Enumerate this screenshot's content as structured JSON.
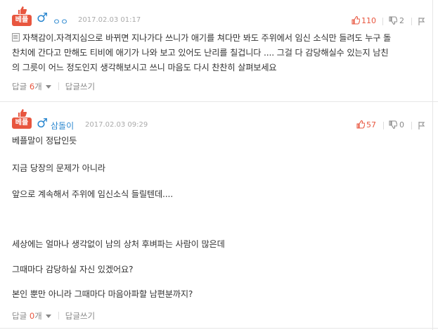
{
  "comments": [
    {
      "badge": "베플",
      "nickname": "ㅇㅇ",
      "date": "2017.02.03 01:17",
      "likes": "110",
      "dislikes": "2",
      "lines": [
        "자책감이.자격지심으로 바뀌면 지나가다 쓰니가 애기를 쳐다만 봐도 주위에서 임신 소식만 들려도 누구 돌",
        "찬치에 간다고 만해도 티비에 애기가 나와 보고 있어도 난리를 칠겁니다 .... 그걸 다 감당해실수 있는지 남친",
        "의 그릇이 어느 정도인지 생각해보시고 쓰니 마음도 다시 찬찬히 살펴보세요"
      ],
      "reply_label": "답글",
      "reply_count": "6",
      "reply_unit": "개",
      "write_reply": "답글쓰기"
    },
    {
      "badge": "베플",
      "nickname": "삼돌이",
      "date": "2017.02.03 09:29",
      "likes": "57",
      "dislikes": "0",
      "lines": [
        "베플말이 정답인듯",
        "지금 당장의 문제가 아니라",
        "앞으로 계속해서 주위에 임신소식 들릴텐데....",
        "세상에는 얼마나 생각없이 남의 상처 후벼파는 사람이 많은데",
        "그때마다 감당하실 자신 있겠어요?",
        "본인 뿐만 아니라 그때마다 마음아파할 남편분까지?"
      ],
      "reply_label": "답글",
      "reply_count": "0",
      "reply_unit": "개",
      "write_reply": "답글쓰기"
    }
  ],
  "colors": {
    "accent": "#e8563f",
    "male": "#2c88d0"
  }
}
